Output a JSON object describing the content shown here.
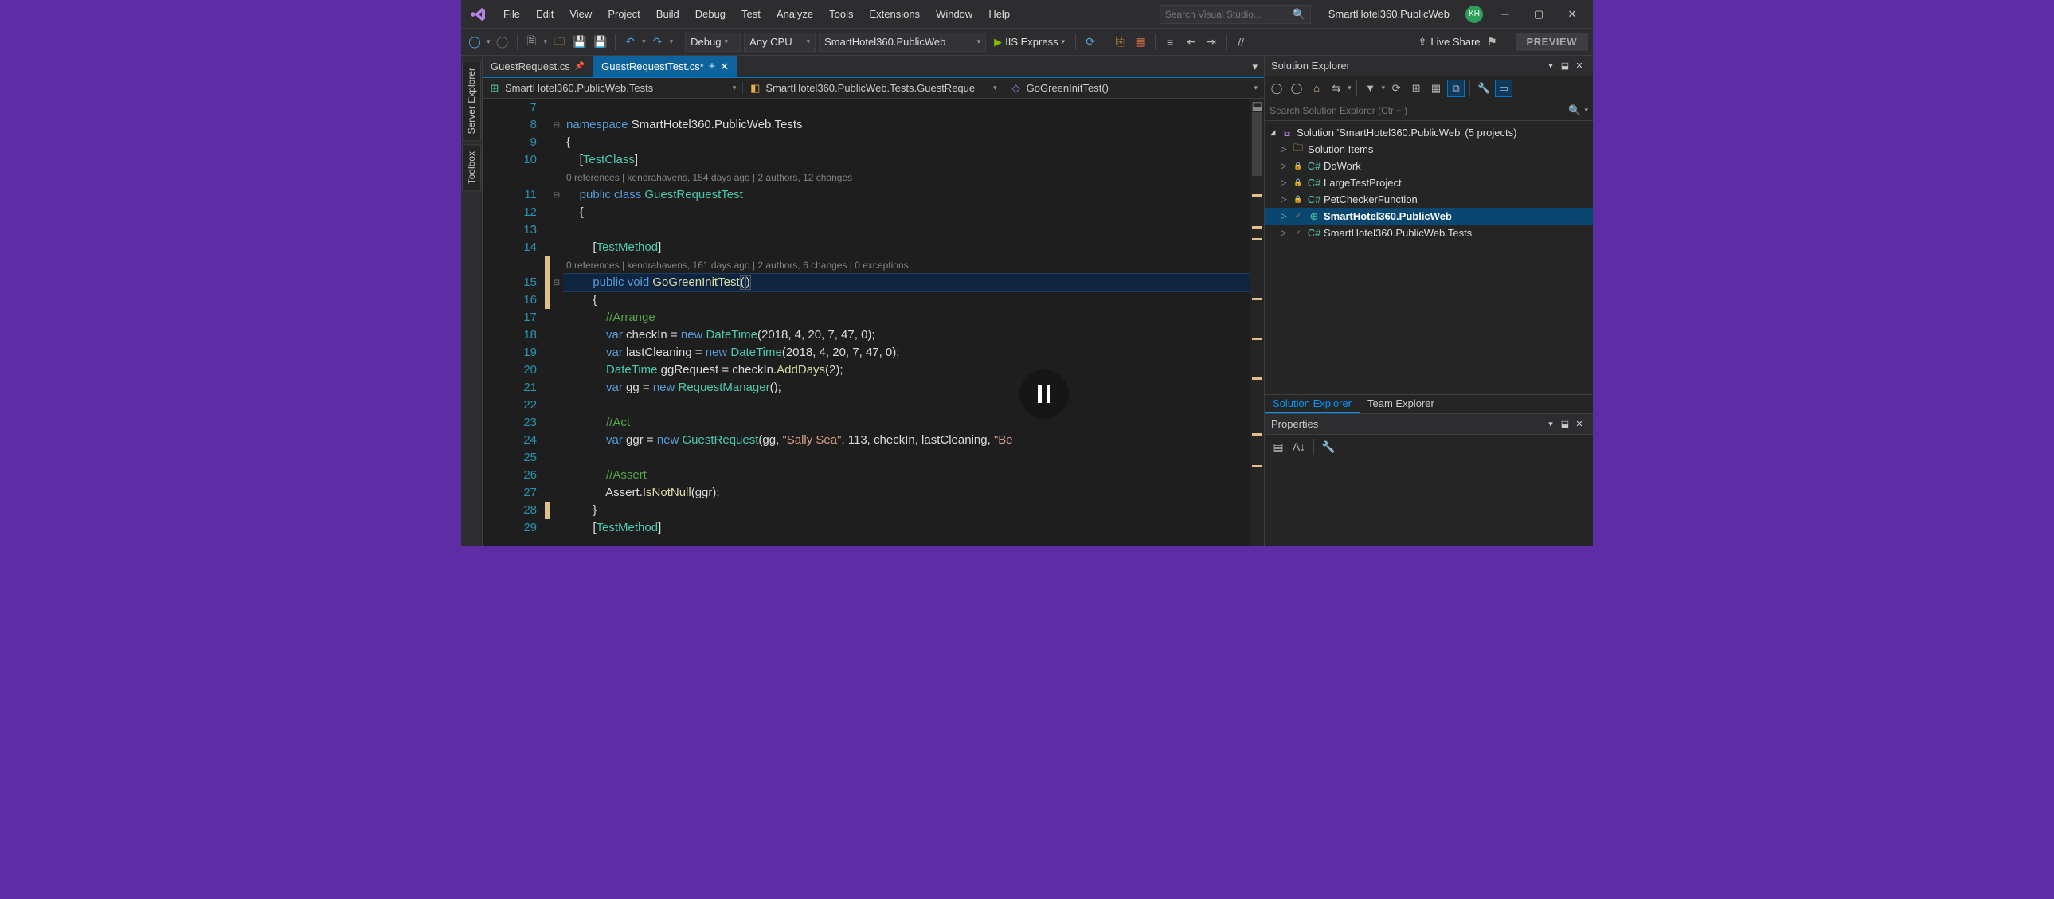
{
  "menu": {
    "items": [
      "File",
      "Edit",
      "View",
      "Project",
      "Build",
      "Debug",
      "Test",
      "Analyze",
      "Tools",
      "Extensions",
      "Window",
      "Help"
    ]
  },
  "search_placeholder": "Search Visual Studio...",
  "app_title": "SmartHotel360.PublicWeb",
  "user_initials": "KH",
  "toolbar": {
    "config": "Debug",
    "platform": "Any CPU",
    "startup": "SmartHotel360.PublicWeb",
    "run_target": "IIS Express",
    "live_share": "Live Share",
    "preview": "PREVIEW"
  },
  "rails": {
    "server_explorer": "Server Explorer",
    "toolbox": "Toolbox"
  },
  "tabs": {
    "inactive": "GuestRequest.cs",
    "active": "GuestRequestTest.cs*"
  },
  "navbar": {
    "project": "SmartHotel360.PublicWeb.Tests",
    "class": "SmartHotel360.PublicWeb.Tests.GuestReque",
    "method": "GoGreenInitTest()"
  },
  "lines": {
    "l7": {
      "n": "7"
    },
    "l8": {
      "n": "8"
    },
    "l9": {
      "n": "9"
    },
    "l10": {
      "n": "10"
    },
    "l10a": {
      "lens": "0 references | kendrahavens, 154 days ago | 2 authors, 12 changes"
    },
    "l11": {
      "n": "11"
    },
    "l12": {
      "n": "12"
    },
    "l13": {
      "n": "13"
    },
    "l14": {
      "n": "14"
    },
    "l14a": {
      "lens": "0 references | kendrahavens, 161 days ago | 2 authors, 6 changes | 0 exceptions"
    },
    "l15": {
      "n": "15"
    },
    "l16": {
      "n": "16"
    },
    "l17": {
      "n": "17"
    },
    "l18": {
      "n": "18"
    },
    "l19": {
      "n": "19"
    },
    "l20": {
      "n": "20"
    },
    "l21": {
      "n": "21"
    },
    "l22": {
      "n": "22"
    },
    "l23": {
      "n": "23"
    },
    "l24": {
      "n": "24"
    },
    "l25": {
      "n": "25"
    },
    "l26": {
      "n": "26"
    },
    "l27": {
      "n": "27"
    },
    "l28": {
      "n": "28"
    },
    "l29": {
      "n": "29"
    }
  },
  "code": {
    "ns_kw": "namespace",
    "ns_name": " SmartHotel360.PublicWeb.Tests",
    "ob": "{",
    "cb": "}",
    "attr_tc_open": "    [",
    "attr_tc": "TestClass",
    "attr_tc_close": "]",
    "cl_mod": "    public class ",
    "cl_name": "GuestRequestTest",
    "ob2": "    {",
    "attr_tm_open": "        [",
    "attr_tm": "TestMethod",
    "attr_tm_close": "]",
    "m_sig1": "        public void ",
    "m_name": "GoGreenInitTest",
    "m_par_open": "(",
    "m_par_close": ")",
    "ob3": "        {",
    "c_arr": "            //Arrange",
    "l18_a": "            var ",
    "l18_b": "checkIn",
    "l18_c": " = ",
    "l18_d": "new ",
    "l18_e": "DateTime",
    "l18_f": "(2018, 4, 20, 7, 47, 0);",
    "l19_a": "            var ",
    "l19_b": "lastCleaning",
    "l19_c": " = ",
    "l19_d": "new ",
    "l19_e": "DateTime",
    "l19_f": "(2018, 4, 20, 7, 47, 0);",
    "l20_a": "            ",
    "l20_b": "DateTime",
    "l20_c": " ggRequest = checkIn.",
    "l20_d": "AddDays",
    "l20_e": "(2);",
    "l21_a": "            var ",
    "l21_b": "gg",
    "l21_c": " = ",
    "l21_d": "new ",
    "l21_e": "RequestManager",
    "l21_f": "();",
    "c_act": "            //Act",
    "l24_a": "            var ",
    "l24_b": "ggr",
    "l24_c": " = ",
    "l24_d": "new ",
    "l24_e": "GuestRequest",
    "l24_f": "(gg, ",
    "l24_g": "\"Sally Sea\"",
    "l24_h": ", 113, checkIn, lastCleaning, ",
    "l24_i": "\"Be",
    "c_ass": "            //Assert",
    "l27_a": "            Assert.",
    "l27_b": "IsNotNull",
    "l27_c": "(ggr);",
    "cb3": "        }",
    "attr_tm2_open": "        [",
    "attr_tm2": "TestMethod",
    "attr_tm2_close": "]"
  },
  "solution_explorer": {
    "title": "Solution Explorer",
    "search_placeholder": "Search Solution Explorer (Ctrl+;)",
    "root": "Solution 'SmartHotel360.PublicWeb' (5 projects)",
    "items": [
      {
        "label": "Solution Items",
        "icon": "folder"
      },
      {
        "label": "DoWork",
        "icon": "csproj"
      },
      {
        "label": "LargeTestProject",
        "icon": "csproj"
      },
      {
        "label": "PetCheckerFunction",
        "icon": "csproj"
      },
      {
        "label": "SmartHotel360.PublicWeb",
        "icon": "csproj",
        "bold": true,
        "git": true
      },
      {
        "label": "SmartHotel360.PublicWeb.Tests",
        "icon": "csproj",
        "git": true
      }
    ],
    "bottom_tabs": {
      "se": "Solution Explorer",
      "te": "Team Explorer"
    }
  },
  "properties": {
    "title": "Properties"
  }
}
